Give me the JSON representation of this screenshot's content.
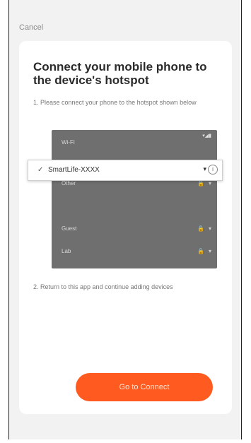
{
  "header": {
    "cancel_label": "Cancel"
  },
  "card": {
    "title": "Connect your mobile phone to the device's hotspot",
    "step1": "1. Please connect your phone to the hotspot shown below",
    "phone": {
      "status_icons": "▾◢▮",
      "wifi_label": "Wi-Fi",
      "rows": [
        {
          "label": "Wi-Fi",
          "icon": "",
          "icon2": ""
        },
        {
          "label": "",
          "icon": "▾",
          "icon2": ""
        },
        {
          "label": "Other",
          "icon": "🔒",
          "icon2": "▾"
        },
        {
          "label": "",
          "icon": "",
          "icon2": ""
        },
        {
          "label": "Guest",
          "icon": "🔒",
          "icon2": "▾"
        },
        {
          "label": "Lab",
          "icon": "🔒",
          "icon2": "▾"
        }
      ],
      "highlighted": {
        "check": "✓",
        "ssid": "SmartLife-XXXX",
        "wifi_icon": "▾",
        "info_icon": "i"
      }
    },
    "step2": "2. Return to this app and continue adding devices",
    "connect_button": "Go to Connect"
  },
  "colors": {
    "accent": "#ff5a1f",
    "background": "#f2f2f2",
    "card": "#ffffff",
    "phone_bg": "#6f6f6f"
  }
}
